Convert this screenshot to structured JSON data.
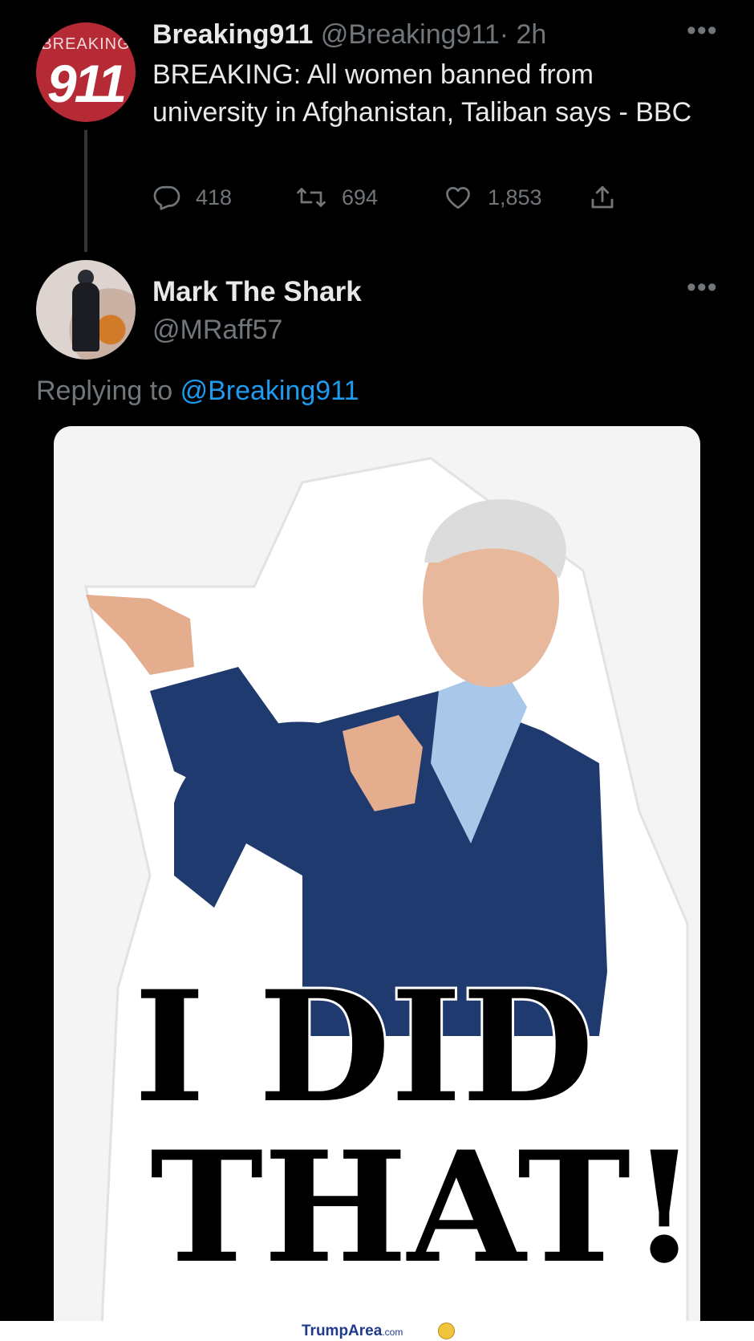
{
  "original_tweet": {
    "avatar_text_top": "BREAKING",
    "avatar_text_num": "911",
    "name": "Breaking911",
    "handle": "@Breaking911",
    "time": "· 2h",
    "text": "BREAKING: All women banned from university in Afghanistan, Taliban says - BBC",
    "more": "•••",
    "actions": {
      "reply_count": "418",
      "retweet_count": "694",
      "like_count": "1,853"
    }
  },
  "reply_tweet": {
    "name": "Mark The Shark",
    "handle": "@MRaff57",
    "more": "•••",
    "replying_prefix": "Replying to",
    "replying_handle": "@Breaking911",
    "media_caption_line1": "I DID",
    "media_caption_line2": "THAT!"
  },
  "footer": {
    "brand_main": "TrumpArea",
    "brand_tld": ".com"
  },
  "colors": {
    "background": "#000000",
    "text_primary": "#e7e9ea",
    "text_secondary": "#71767b",
    "link": "#1d9bf0",
    "avatar_red": "#b52a35",
    "suit_navy": "#1f3a6e"
  },
  "icons": [
    "reply-icon",
    "retweet-icon",
    "like-icon",
    "share-icon",
    "more-icon"
  ]
}
